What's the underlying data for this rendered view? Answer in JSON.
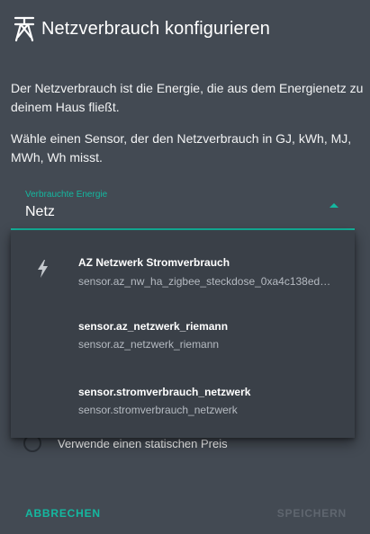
{
  "dialog": {
    "title": "Netzverbrauch konfigurieren",
    "title_icon": "transmission-tower-icon",
    "description_1": "Der Netzverbrauch ist die Energie, die aus dem Energienetz zu deinem Haus fließt.",
    "description_2": "Wähle einen Sensor, der den Netzverbrauch in GJ, kWh, MJ, MWh, Wh misst."
  },
  "select": {
    "label": "Verbrauchte Energie",
    "value": "Netz",
    "accent_color": "#14b8a0"
  },
  "dropdown": {
    "items": [
      {
        "icon": "lightning-bolt-icon",
        "primary": "AZ Netzwerk Stromverbrauch",
        "secondary": "sensor.az_nw_ha_zigbee_steckdose_0xa4c138ed…"
      },
      {
        "icon": "",
        "primary": "sensor.az_netzwerk_riemann",
        "secondary": "sensor.az_netzwerk_riemann"
      },
      {
        "icon": "",
        "primary": "sensor.stromverbrauch_netzwerk",
        "secondary": "sensor.stromverbrauch_netzwerk"
      }
    ]
  },
  "option": {
    "static_price_label": "Verwende einen statischen Preis"
  },
  "actions": {
    "cancel_label": "ABBRECHEN",
    "save_label": "SPEICHERN"
  },
  "colors": {
    "background": "#434a53",
    "menu_background": "#3a4048",
    "accent": "#14b8a0",
    "disabled": "#5f666f"
  }
}
